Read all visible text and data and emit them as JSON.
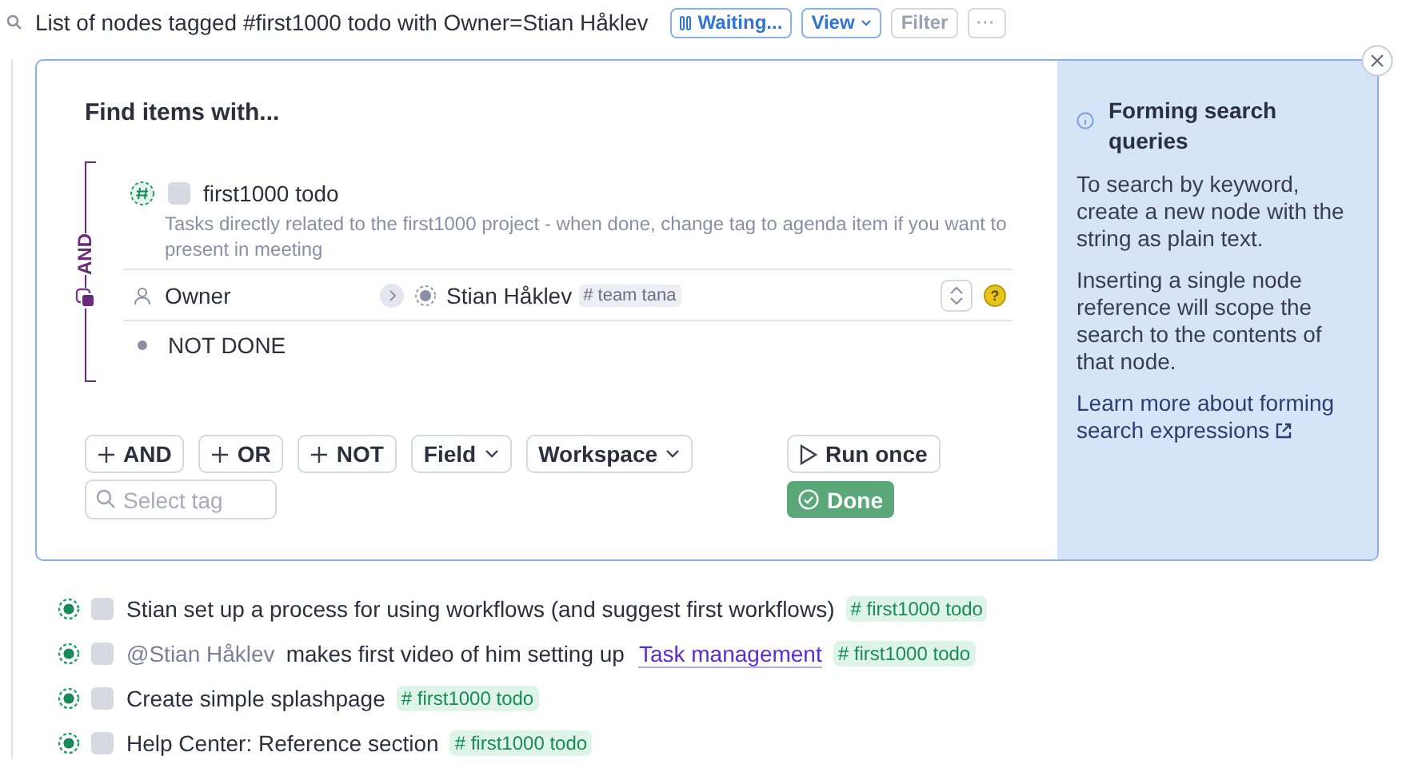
{
  "header": {
    "title": "List of nodes tagged #first1000 todo with Owner=Stian Håklev",
    "buttons": [
      {
        "kind": "status",
        "label": "Waiting..."
      },
      {
        "kind": "dropdown",
        "label": "View"
      },
      {
        "kind": "plain",
        "label": "Filter"
      },
      {
        "kind": "more",
        "label": "···"
      }
    ]
  },
  "query": {
    "title": "Find items with...",
    "operator": "AND",
    "tag": {
      "checked": false,
      "name": "first1000 todo",
      "description": "Tasks directly related to the first1000 project - when done, change tag to agenda item if you want to present in meeting"
    },
    "field": {
      "name": "Owner",
      "value": "Stian Håklev",
      "value_tag": "# team tana",
      "help": "?"
    },
    "condition": "NOT DONE",
    "actions": [
      {
        "kind": "add",
        "label": "AND"
      },
      {
        "kind": "add",
        "label": "OR"
      },
      {
        "kind": "add",
        "label": "NOT"
      },
      {
        "kind": "dropdown",
        "label": "Field"
      },
      {
        "kind": "dropdown",
        "label": "Workspace"
      }
    ],
    "search": {
      "placeholder": "Select tag"
    },
    "run_button": "Run once",
    "done_button": "Done"
  },
  "help": {
    "title": "Forming search queries",
    "paragraphs": [
      "To search by keyword, create a new node with the string as plain text.",
      "Inserting a single node reference will scope the search to the contents of that node."
    ],
    "link": "Learn more about forming search expressions"
  },
  "results": [
    {
      "checked": false,
      "parts": [
        {
          "kind": "text",
          "text": "Stian set up a process for using workflows (and suggest first workflows)"
        },
        {
          "kind": "tag",
          "text": "# first1000 todo"
        }
      ]
    },
    {
      "checked": false,
      "parts": [
        {
          "kind": "mention",
          "text": "@Stian Håklev"
        },
        {
          "kind": "text",
          "text": "makes first video of him setting up"
        },
        {
          "kind": "link",
          "text": "Task management"
        },
        {
          "kind": "tag",
          "text": "# first1000 todo"
        }
      ]
    },
    {
      "checked": false,
      "parts": [
        {
          "kind": "text",
          "text": "Create simple splashpage"
        },
        {
          "kind": "tag",
          "text": "# first1000 todo"
        }
      ]
    },
    {
      "checked": false,
      "parts": [
        {
          "kind": "text",
          "text": "Help Center: Reference section"
        },
        {
          "kind": "tag",
          "text": "# first1000 todo"
        }
      ]
    }
  ]
}
